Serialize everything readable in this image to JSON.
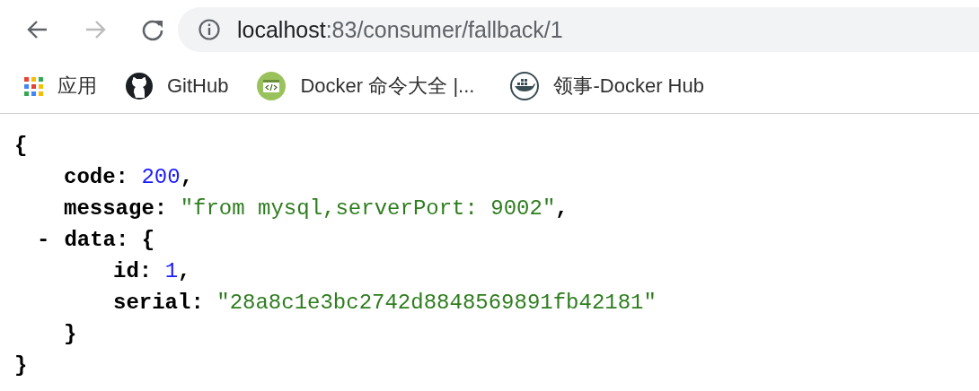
{
  "toolbar": {
    "back": {
      "disabled": false
    },
    "forward": {
      "disabled": true
    },
    "address": {
      "host": "localhost",
      "path": ":83/consumer/fallback/1"
    }
  },
  "bookmarks": [
    {
      "kind": "apps",
      "label": "应用"
    },
    {
      "kind": "github",
      "label": "GitHub"
    },
    {
      "kind": "code",
      "label": "Docker 命令大全 |..."
    },
    {
      "kind": "docker",
      "label": "领事-Docker Hub"
    }
  ],
  "json_lines": [
    {
      "tokens": [
        {
          "kind": "punct",
          "text": "{"
        }
      ],
      "children": [
        {
          "tokens": [
            {
              "kind": "key",
              "text": "code"
            },
            {
              "kind": "punct",
              "text": ": "
            },
            {
              "kind": "number",
              "text": "200"
            },
            {
              "kind": "punct",
              "text": ","
            }
          ]
        },
        {
          "tokens": [
            {
              "kind": "key",
              "text": "message"
            },
            {
              "kind": "punct",
              "text": ": "
            },
            {
              "kind": "string",
              "text": "\"from mysql,serverPort: 9002\""
            },
            {
              "kind": "punct",
              "text": ","
            }
          ]
        },
        {
          "tokens": [
            {
              "kind": "toggle",
              "text": "-"
            },
            {
              "kind": "key",
              "text": "data"
            },
            {
              "kind": "punct",
              "text": ": {"
            }
          ],
          "children": [
            {
              "tokens": [
                {
                  "kind": "key",
                  "text": "id"
                },
                {
                  "kind": "punct",
                  "text": ": "
                },
                {
                  "kind": "number",
                  "text": "1"
                },
                {
                  "kind": "punct",
                  "text": ","
                }
              ]
            },
            {
              "tokens": [
                {
                  "kind": "key",
                  "text": "serial"
                },
                {
                  "kind": "punct",
                  "text": ": "
                },
                {
                  "kind": "string",
                  "text": "\"28a8c1e3bc2742d8848569891fb42181\""
                }
              ]
            }
          ]
        },
        {
          "tokens": [
            {
              "kind": "punct",
              "text": "}"
            }
          ]
        }
      ]
    },
    {
      "tokens": [
        {
          "kind": "punct",
          "text": "}"
        }
      ]
    }
  ]
}
